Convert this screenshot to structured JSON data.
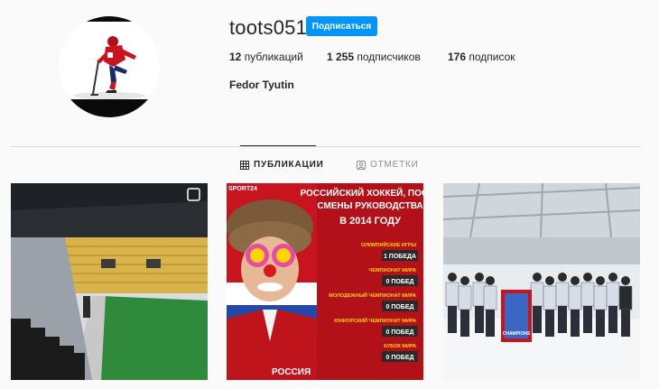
{
  "profile": {
    "username": "toots051",
    "follow_label": "Подписаться",
    "full_name": "Fedor Tyutin",
    "stats": {
      "posts_count": "12",
      "posts_label": "публикаций",
      "followers_count": "1 255",
      "followers_label": "подписчиков",
      "following_count": "176",
      "following_label": "подписок"
    }
  },
  "tabs": [
    {
      "label": "ПУБЛИКАЦИИ",
      "icon": "grid-icon",
      "active": true
    },
    {
      "label": "ОТМЕТКИ",
      "icon": "tagged-icon",
      "active": false
    }
  ],
  "posts": {
    "post2": {
      "banner": "SPORT24",
      "title_line1": "РОССИЙСКИЙ ХОККЕЙ, ПОСЛЕ",
      "title_line2": "СМЕНЫ РУКОВОДСТВА",
      "title_line3": "В 2014 ГОДУ",
      "rows": [
        {
          "label": "ОЛИМПИЙСКИЕ ИГРЫ",
          "value": "1 ПОБЕДА"
        },
        {
          "label": "ЧЕМПИОНАТ МИРА",
          "value": "0 ПОБЕД"
        },
        {
          "label": "МОЛОДЕЖНЫЙ ЧЕМПИОНАТ МИРА",
          "value": "0 ПОБЕД"
        },
        {
          "label": "ЮНИОРСКИЙ ЧЕМПИОНАТ МИРА",
          "value": "0 ПОБЕД"
        },
        {
          "label": "КУБОК МИРА",
          "value": "0 ПОБЕД"
        }
      ],
      "shirt_text": "РОССИЯ"
    },
    "post3": {
      "banner_text": "CHAMPIONS"
    }
  },
  "colors": {
    "accent": "#0095f6",
    "poster_red": "#c8141e",
    "divider": "#dbdbdb"
  }
}
